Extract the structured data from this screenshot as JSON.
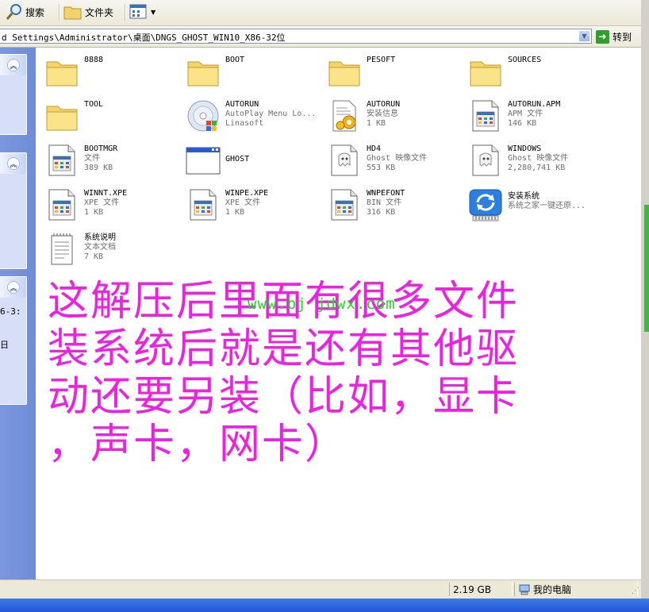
{
  "toolbar": {
    "search_label": "搜索",
    "folders_label": "文件夹"
  },
  "address": {
    "path": "d Settings\\Administrator\\桌面\\DNGS_GHOST_WIN10_X86-32位",
    "go_label": "转到"
  },
  "taskpane": {
    "text1": "6-3:",
    "text2": "日"
  },
  "files": [
    {
      "name": "8888",
      "line2": "",
      "line3": "",
      "icon": "folder-icon"
    },
    {
      "name": "BOOT",
      "line2": "",
      "line3": "",
      "icon": "folder-icon"
    },
    {
      "name": "PESOFT",
      "line2": "",
      "line3": "",
      "icon": "folder-icon"
    },
    {
      "name": "SOURCES",
      "line2": "",
      "line3": "",
      "icon": "folder-icon"
    },
    {
      "name": "TOOL",
      "line2": "",
      "line3": "",
      "icon": "folder-icon"
    },
    {
      "name": "AUTORUN",
      "line2": "AutoPlay Menu Lo...",
      "line3": "Linasoft",
      "icon": "autoplay-cd-icon"
    },
    {
      "name": "AUTORUN",
      "line2": "安装信息",
      "line3": "1 KB",
      "icon": "setup-info-icon"
    },
    {
      "name": "AUTORUN.APM",
      "line2": "APM 文件",
      "line3": "146 KB",
      "icon": "generic-file-icon"
    },
    {
      "name": "BOOTMGR",
      "line2": "文件",
      "line3": "389 KB",
      "icon": "generic-file-icon"
    },
    {
      "name": "GHOST",
      "line2": "",
      "line3": "",
      "icon": "application-window-icon"
    },
    {
      "name": "HD4",
      "line2": "Ghost 映像文件",
      "line3": "553 KB",
      "icon": "ghost-image-icon"
    },
    {
      "name": "WINDOWS",
      "line2": "Ghost 映像文件",
      "line3": "2,280,741 KB",
      "icon": "ghost-image-icon"
    },
    {
      "name": "WINNT.XPE",
      "line2": "XPE 文件",
      "line3": "1 KB",
      "icon": "generic-file-icon"
    },
    {
      "name": "WINPE.XPE",
      "line2": "XPE 文件",
      "line3": "1 KB",
      "icon": "generic-file-icon"
    },
    {
      "name": "WNPEFONT",
      "line2": "BIN 文件",
      "line3": "316 KB",
      "icon": "generic-file-icon"
    },
    {
      "name": "安装系统",
      "line2": "系统之家一键还原...",
      "line3": "",
      "icon": "restore-app-icon"
    },
    {
      "name": "系统说明",
      "line2": "文本文档",
      "line3": "7 KB",
      "icon": "text-document-icon"
    }
  ],
  "overlay": {
    "line1": "这解压后里面有很多文件",
    "line2": "装系统后就是还有其他驱",
    "line3": "动还要另装（比如，显卡",
    "line4": "，声卡，网卡）",
    "watermark": "www.bj jdwx.com"
  },
  "status": {
    "size": "2.19 GB",
    "location": "我的电脑"
  },
  "colors": {
    "overlay_text": "#ec22e0",
    "watermark": "#1ed81e",
    "taskpane": "#7b97dc"
  }
}
